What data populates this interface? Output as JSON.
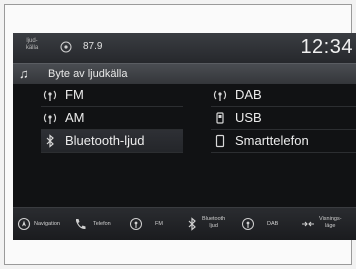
{
  "status": {
    "source_tag": "ljud-\nkälla",
    "frequency": "87.9",
    "clock": "12:34"
  },
  "header": {
    "title": "Byte av ljudkälla"
  },
  "sources": [
    {
      "label": "FM",
      "icon": "fm-radio-icon"
    },
    {
      "label": "AM",
      "icon": "am-radio-icon"
    },
    {
      "label": "Bluetooth-ljud",
      "icon": "bluetooth-icon"
    },
    {
      "label": "DAB",
      "icon": "dab-radio-icon"
    },
    {
      "label": "USB",
      "icon": "usb-icon"
    },
    {
      "label": "Smarttelefon",
      "icon": "smartphone-icon"
    }
  ],
  "bottom_bar": [
    {
      "label": "Navigation",
      "icon": "navigation-icon"
    },
    {
      "label": "Telefon",
      "icon": "phone-icon"
    },
    {
      "label": "FM",
      "icon": "fm-radio-icon"
    },
    {
      "label": "Bluetooth\nljud",
      "icon": "bluetooth-icon"
    },
    {
      "label": "DAB",
      "icon": "dab-radio-icon"
    },
    {
      "label": "Visnings-\nläge",
      "icon": "display-mode-icon"
    }
  ]
}
